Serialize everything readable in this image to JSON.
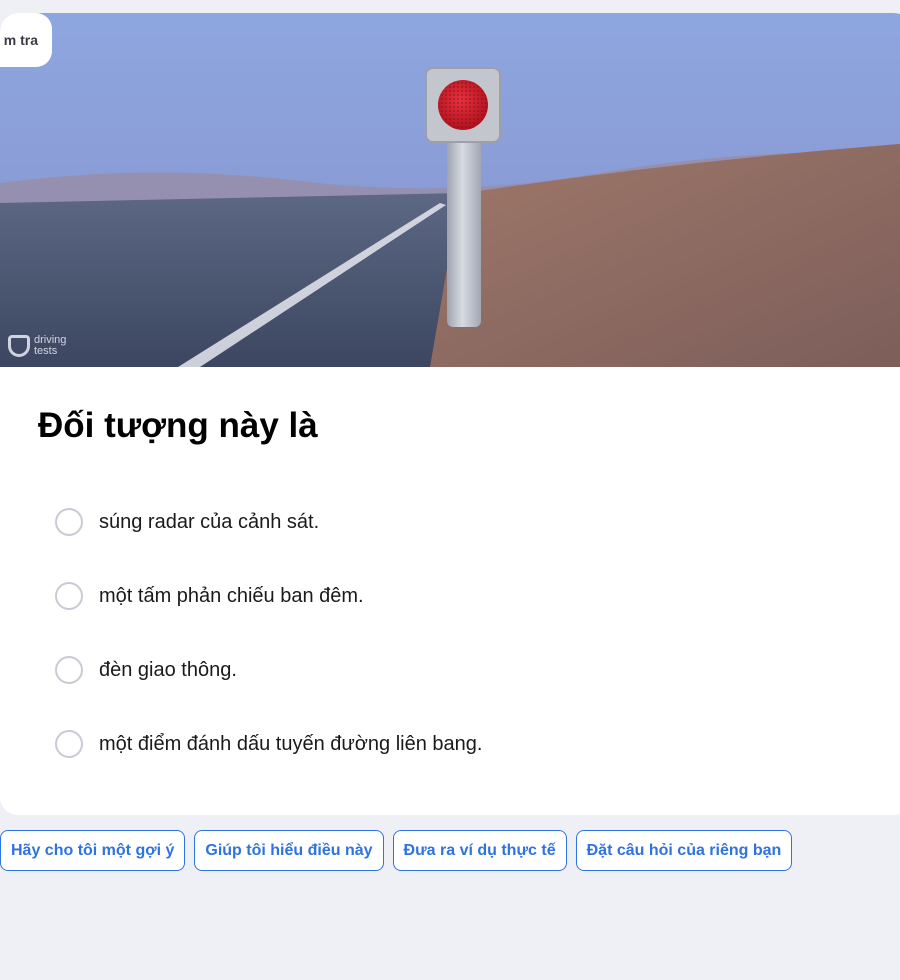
{
  "badge": {
    "label": "m tra"
  },
  "hero": {
    "watermark_line1": "driving",
    "watermark_line2": "tests"
  },
  "question": {
    "title": "Đối tượng này là"
  },
  "options": [
    {
      "label": "súng radar của cảnh sát."
    },
    {
      "label": "một tấm phản chiếu ban đêm."
    },
    {
      "label": "đèn giao thông."
    },
    {
      "label": "một điểm đánh dấu tuyến đường liên bang."
    }
  ],
  "suggestions": [
    {
      "label": "Hãy cho tôi một gợi ý"
    },
    {
      "label": "Giúp tôi hiểu điều này"
    },
    {
      "label": "Đưa ra ví dụ thực tế"
    },
    {
      "label": "Đặt câu hỏi của riêng bạn"
    }
  ],
  "colors": {
    "accent": "#2f73e0",
    "page_background": "#eff0f6",
    "reflector_red": "#d81e2c"
  }
}
